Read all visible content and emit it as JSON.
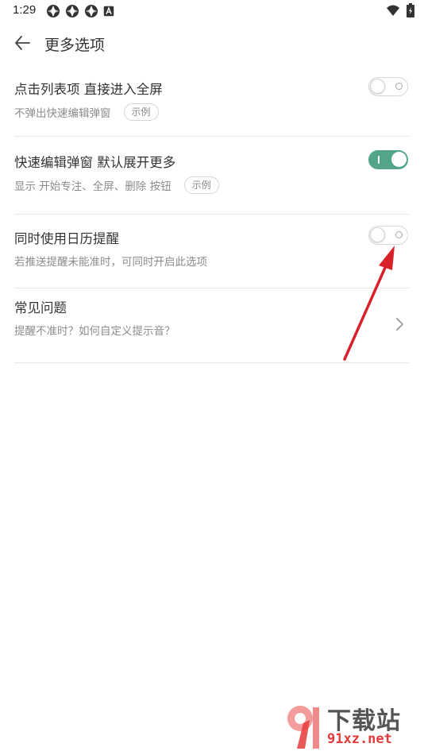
{
  "status_bar": {
    "time": "1:29",
    "icons": [
      "app-icon",
      "app-icon",
      "app-icon",
      "font-icon",
      "wifi-icon",
      "battery-icon"
    ]
  },
  "header": {
    "title": "更多选项",
    "back_icon": "arrow-left-icon"
  },
  "settings": [
    {
      "title": "点击列表项 直接进入全屏",
      "subtitle": "不弹出快速编辑弹窗",
      "example_label": "示例",
      "toggle_on": false
    },
    {
      "title": "快速编辑弹窗 默认展开更多",
      "subtitle": "显示 开始专注、全屏、删除 按钮",
      "example_label": "示例",
      "toggle_on": true
    },
    {
      "title": "同时使用日历提醒",
      "subtitle": "若推送提醒未能准时，可同时开启此选项",
      "toggle_on": false
    },
    {
      "title": "常见问题",
      "subtitle": "提醒不准时？如何自定义提示音？",
      "chevron_icon": "chevron-right-icon"
    }
  ],
  "colors": {
    "accent_green": "#52a586",
    "annotation_red": "#d8212b"
  },
  "watermark": {
    "text": "下载站",
    "url": "91xz.net"
  }
}
